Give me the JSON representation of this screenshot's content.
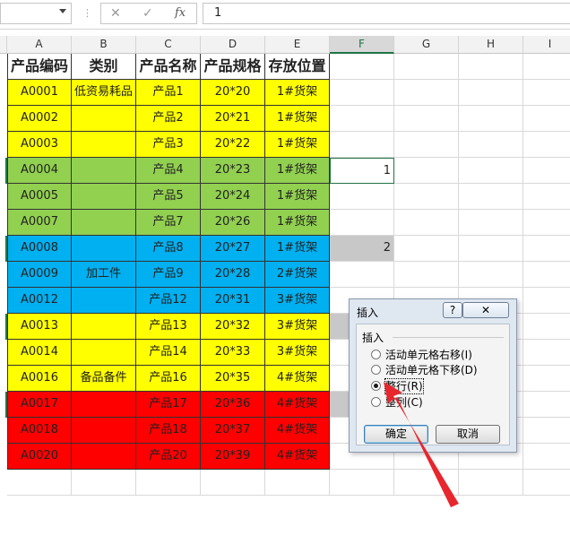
{
  "formula_bar": {
    "name_box": "",
    "cancel_icon": "✕",
    "confirm_icon": "✓",
    "fx_label": "fx",
    "formula_value": "1"
  },
  "columns": [
    "A",
    "B",
    "C",
    "D",
    "E",
    "F",
    "G",
    "H",
    "I"
  ],
  "selected_column": "F",
  "table": {
    "headers": [
      "产品编码",
      "类别",
      "产品名称",
      "产品规格",
      "存放位置"
    ],
    "rows": [
      {
        "code": "A0001",
        "category": "低资易耗品",
        "name": "产品1",
        "spec": "20*20",
        "location": "1#货架",
        "f": "",
        "color": "#ffff00"
      },
      {
        "code": "A0002",
        "category": "",
        "name": "产品2",
        "spec": "20*21",
        "location": "1#货架",
        "f": "",
        "color": "#ffff00"
      },
      {
        "code": "A0003",
        "category": "",
        "name": "产品3",
        "spec": "20*22",
        "location": "1#货架",
        "f": "",
        "color": "#ffff00"
      },
      {
        "code": "A0004",
        "category": "",
        "name": "产品4",
        "spec": "20*23",
        "location": "1#货架",
        "f": "1",
        "color": "#92d050"
      },
      {
        "code": "A0005",
        "category": "",
        "name": "产品5",
        "spec": "20*24",
        "location": "1#货架",
        "f": "",
        "color": "#92d050"
      },
      {
        "code": "A0007",
        "category": "",
        "name": "产品7",
        "spec": "20*26",
        "location": "1#货架",
        "f": "",
        "color": "#92d050"
      },
      {
        "code": "A0008",
        "category": "",
        "name": "产品8",
        "spec": "20*27",
        "location": "1#货架",
        "f": "2",
        "color": "#00b0f0"
      },
      {
        "code": "A0009",
        "category": "加工件",
        "name": "产品9",
        "spec": "20*28",
        "location": "2#货架",
        "f": "",
        "color": "#00b0f0"
      },
      {
        "code": "A0012",
        "category": "",
        "name": "产品12",
        "spec": "20*31",
        "location": "3#货架",
        "f": "",
        "color": "#00b0f0"
      },
      {
        "code": "A0013",
        "category": "",
        "name": "产品13",
        "spec": "20*32",
        "location": "3#货架",
        "f": "",
        "color": "#ffff00"
      },
      {
        "code": "A0014",
        "category": "",
        "name": "产品14",
        "spec": "20*33",
        "location": "3#货架",
        "f": "",
        "color": "#ffff00"
      },
      {
        "code": "A0016",
        "category": "备品备件",
        "name": "产品16",
        "spec": "20*35",
        "location": "4#货架",
        "f": "",
        "color": "#ffff00"
      },
      {
        "code": "A0017",
        "category": "",
        "name": "产品17",
        "spec": "20*36",
        "location": "4#货架",
        "f": "",
        "color": "#ff0000"
      },
      {
        "code": "A0018",
        "category": "",
        "name": "产品18",
        "spec": "20*37",
        "location": "4#货架",
        "f": "",
        "color": "#ff0000"
      },
      {
        "code": "A0020",
        "category": "",
        "name": "产品20",
        "spec": "20*39",
        "location": "4#货架",
        "f": "",
        "color": "#ff0000"
      }
    ]
  },
  "dialog": {
    "title": "插入",
    "help": "?",
    "close": "✕",
    "group_label": "插入",
    "options": [
      {
        "label": "活动单元格右移(I)",
        "selected": false
      },
      {
        "label": "活动单元格下移(D)",
        "selected": false
      },
      {
        "label": "整行(R)",
        "selected": true
      },
      {
        "label": "整列(C)",
        "selected": false
      }
    ],
    "ok": "确定",
    "cancel": "取消"
  },
  "colors": {
    "accent_green": "#217346",
    "arrow_red": "#e8262d"
  }
}
